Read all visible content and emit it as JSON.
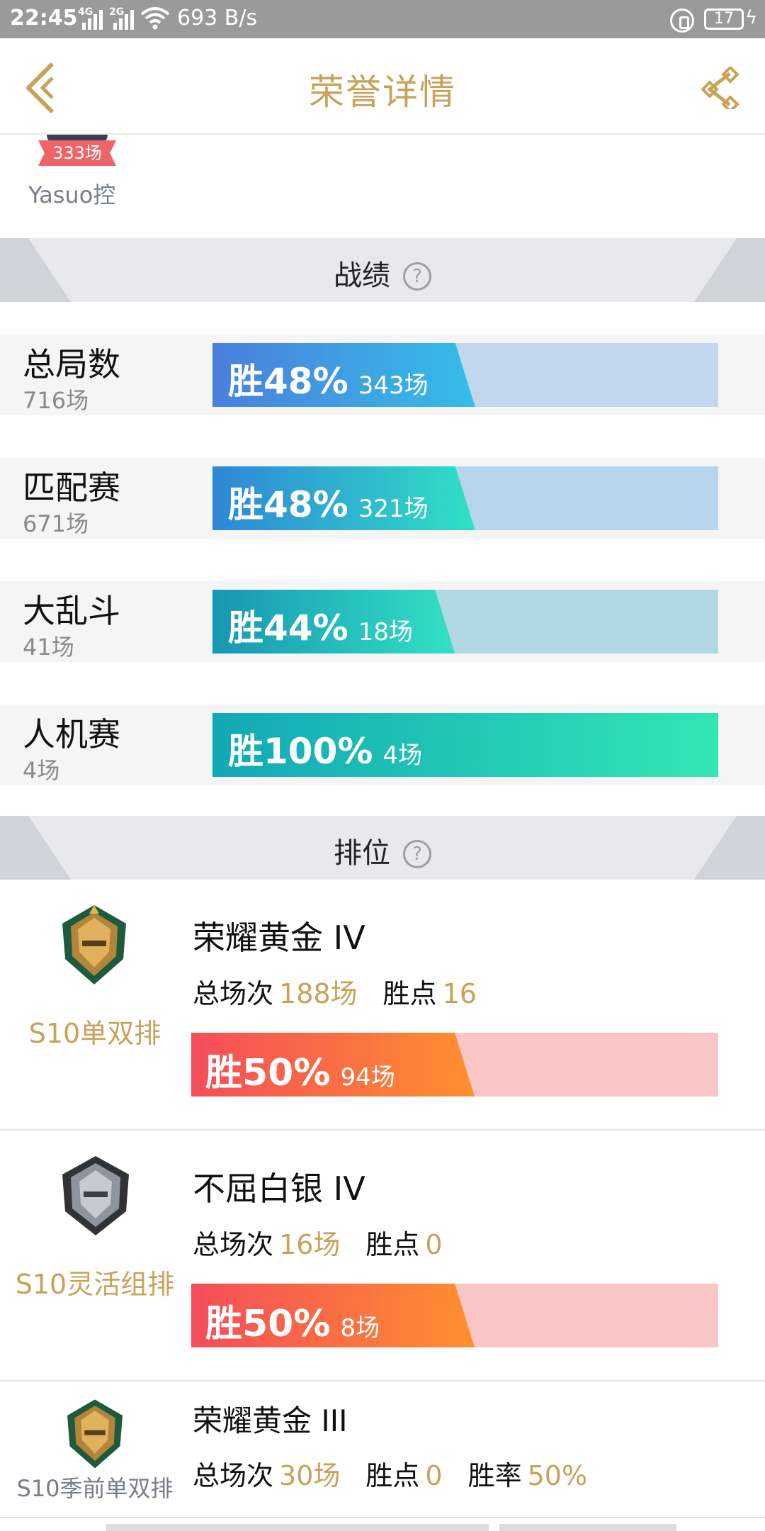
{
  "status_bar": {
    "time": "22:45",
    "net1": "4G",
    "net2": "2G",
    "speed": "693 B/s",
    "battery": "17"
  },
  "header": {
    "title": "荣誉详情"
  },
  "profile": {
    "badge": "333场",
    "nickname": "Yasuo控"
  },
  "sections": {
    "stats_title": "战绩",
    "rank_title": "排位",
    "help": "?"
  },
  "stats": [
    {
      "name": "总局数",
      "count": "716场",
      "win_pct": "胜48%",
      "wins": "343场",
      "win_rate": 0.48,
      "color_from": "#4a7fdc",
      "color_to": "#35bde9",
      "track": "#c2d6ee"
    },
    {
      "name": "匹配赛",
      "count": "671场",
      "win_pct": "胜48%",
      "wins": "321场",
      "win_rate": 0.48,
      "color_from": "#2f86d8",
      "color_to": "#2fe0c4",
      "track": "#b8d5ee"
    },
    {
      "name": "大乱斗",
      "count": "41场",
      "win_pct": "胜44%",
      "wins": "18场",
      "win_rate": 0.44,
      "color_from": "#1796b3",
      "color_to": "#33e0c5",
      "track": "#b0d9e3"
    },
    {
      "name": "人机赛",
      "count": "4场",
      "win_pct": "胜100%",
      "wins": "4场",
      "win_rate": 1.0,
      "color_from": "#12a8b6",
      "color_to": "#32e6b4",
      "track": "#b0e3dd"
    }
  ],
  "ranks": [
    {
      "queue": "S10单双排",
      "tier": "荣耀黄金 IV",
      "total_label": "总场次",
      "total": "188场",
      "lp_label": "胜点",
      "lp": "16",
      "win_pct": "胜50%",
      "wins": "94场",
      "win_rate": 0.5,
      "emblem": "gold-emblem-icon"
    },
    {
      "queue": "S10灵活组排",
      "tier": "不屈白银 IV",
      "total_label": "总场次",
      "total": "16场",
      "lp_label": "胜点",
      "lp": "0",
      "win_pct": "胜50%",
      "wins": "8场",
      "win_rate": 0.5,
      "emblem": "silver-emblem-icon"
    },
    {
      "queue": "S10季前单双排",
      "tier": "荣耀黄金 III",
      "total_label": "总场次",
      "total": "30场",
      "lp_label": "胜点",
      "lp": "0",
      "wr_label": "胜率",
      "wr": "50%",
      "emblem": "gold-emblem-icon"
    }
  ]
}
